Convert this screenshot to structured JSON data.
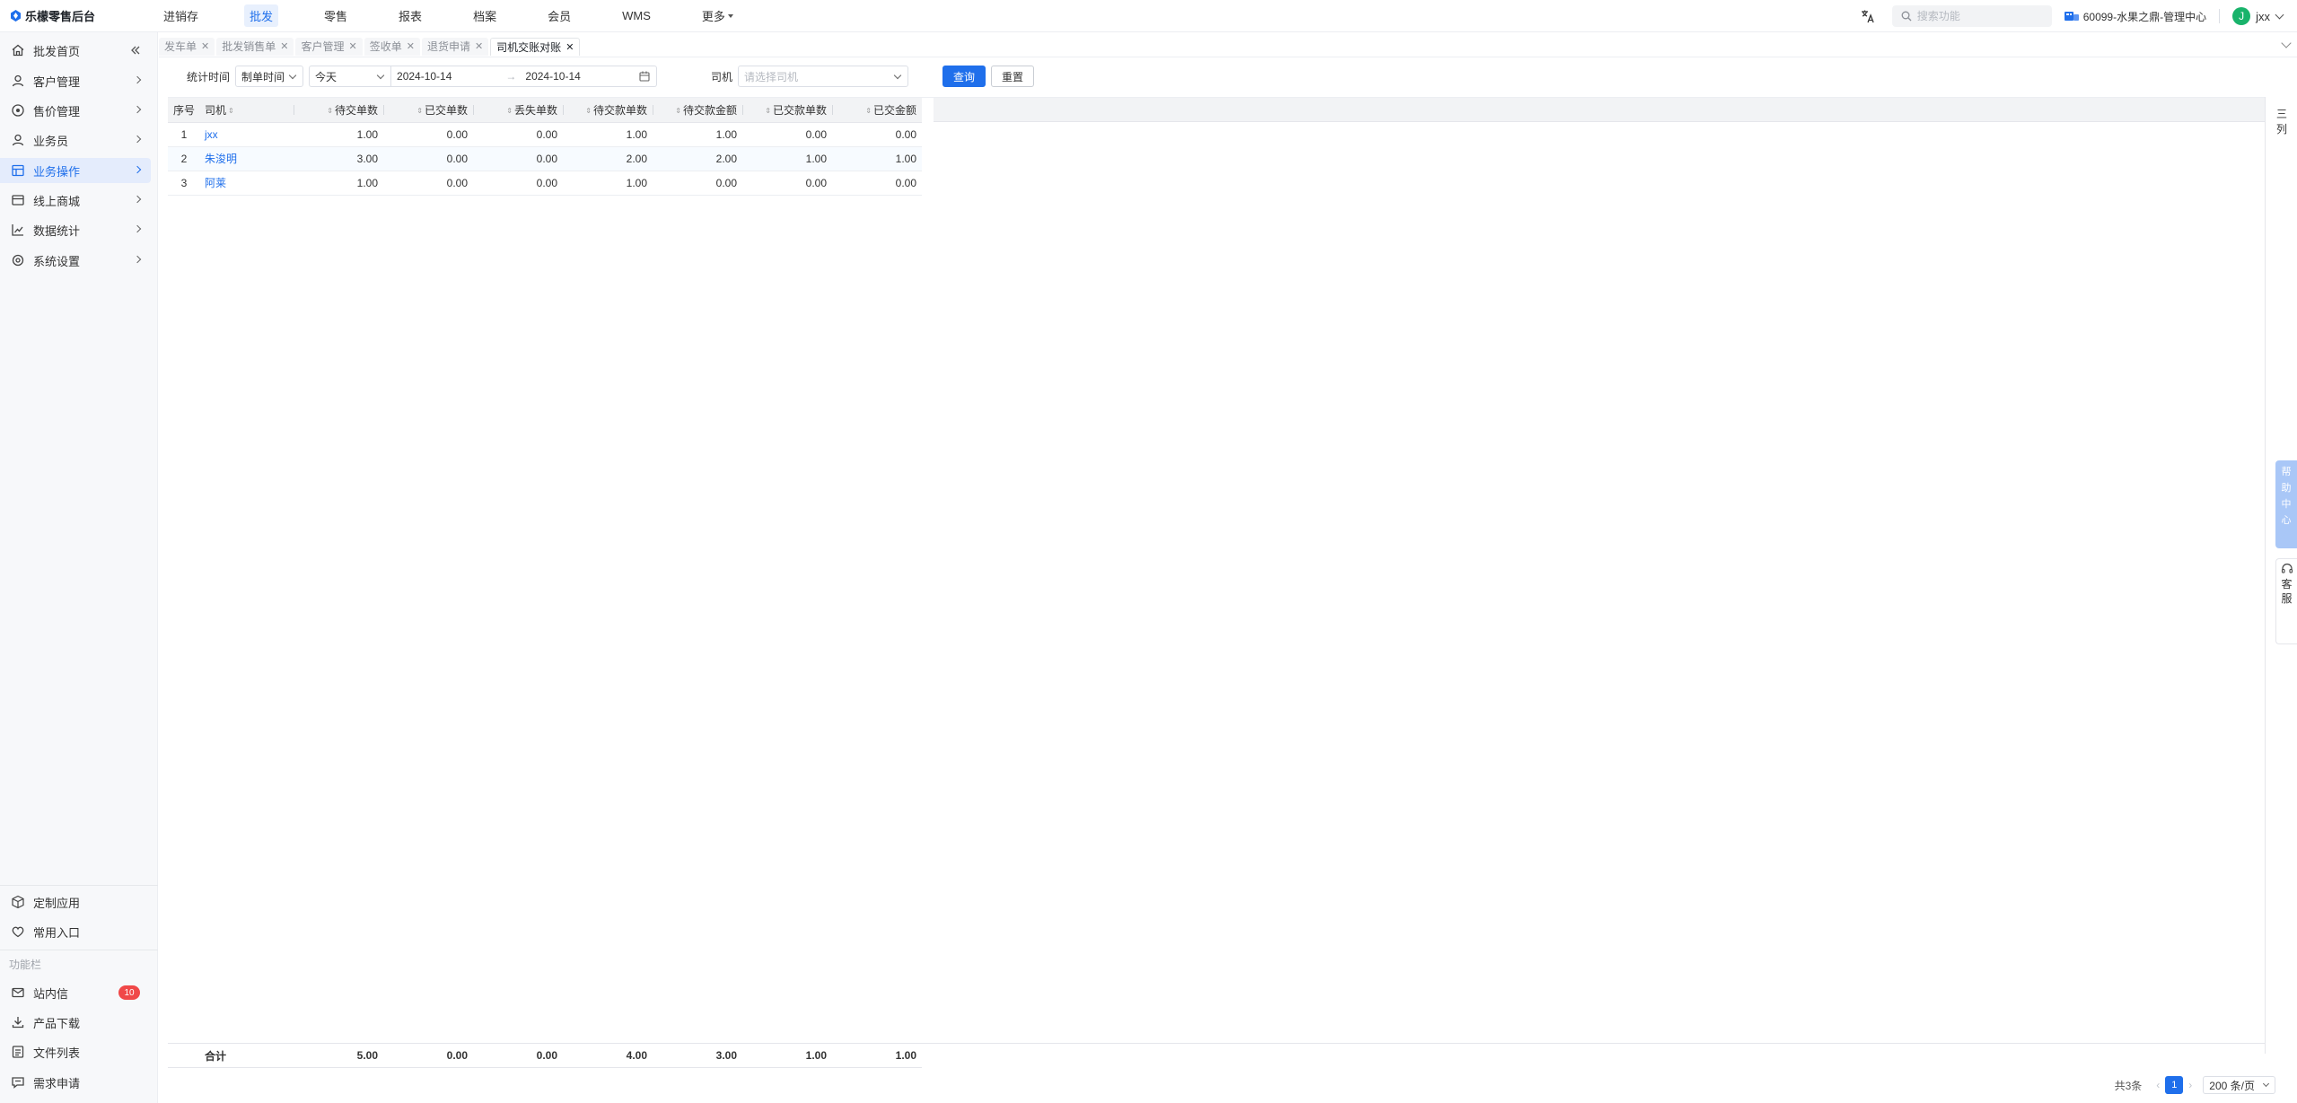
{
  "app": {
    "title": "乐檬零售后台"
  },
  "top_nav": [
    {
      "label": "进销存",
      "active": false
    },
    {
      "label": "批发",
      "active": true
    },
    {
      "label": "零售",
      "active": false
    },
    {
      "label": "报表",
      "active": false
    },
    {
      "label": "档案",
      "active": false
    },
    {
      "label": "会员",
      "active": false
    },
    {
      "label": "WMS",
      "active": false
    },
    {
      "label": "更多",
      "active": false
    }
  ],
  "search": {
    "placeholder": "搜索功能"
  },
  "store": {
    "name": "60099-水果之鼎-管理中心"
  },
  "user": {
    "initial": "J",
    "name": "jxx"
  },
  "sidebar": {
    "items": [
      {
        "label": "批发首页",
        "icon": "home-icon"
      },
      {
        "label": "客户管理",
        "icon": "user-icon"
      },
      {
        "label": "售价管理",
        "icon": "price-icon"
      },
      {
        "label": "业务员",
        "icon": "user-icon"
      },
      {
        "label": "业务操作",
        "icon": "operation-icon",
        "active": true
      },
      {
        "label": "线上商城",
        "icon": "shop-icon"
      },
      {
        "label": "数据统计",
        "icon": "chart-icon"
      },
      {
        "label": "系统设置",
        "icon": "gear-icon"
      }
    ],
    "bottom_items": [
      {
        "label": "定制应用",
        "icon": "cube-icon"
      },
      {
        "label": "常用入口",
        "icon": "heart-icon"
      }
    ],
    "caption": "功能栏",
    "tool_items": [
      {
        "label": "站内信",
        "icon": "mail-icon",
        "badge": "10"
      },
      {
        "label": "产品下载",
        "icon": "download-icon"
      },
      {
        "label": "文件列表",
        "icon": "file-icon"
      },
      {
        "label": "需求申请",
        "icon": "message-icon"
      }
    ]
  },
  "tabs": [
    {
      "label": "发车单",
      "active": false
    },
    {
      "label": "批发销售单",
      "active": false
    },
    {
      "label": "客户管理",
      "active": false
    },
    {
      "label": "签收单",
      "active": false
    },
    {
      "label": "退货申请",
      "active": false
    },
    {
      "label": "司机交账对账",
      "active": true
    }
  ],
  "filters": {
    "time_label": "统计时间",
    "time_type": "制单时间",
    "range_preset": "今天",
    "date_start": "2024-10-14",
    "date_end": "2024-10-14",
    "driver_label": "司机",
    "driver_placeholder": "请选择司机",
    "query_button": "查询",
    "reset_button": "重置"
  },
  "table": {
    "columns": [
      "序号",
      "司机",
      "待交单数",
      "已交单数",
      "丢失单数",
      "待交款单数",
      "待交款金额",
      "已交款单数",
      "已交金额"
    ],
    "rows": [
      [
        "1",
        "jxx",
        "1.00",
        "0.00",
        "0.00",
        "1.00",
        "1.00",
        "0.00",
        "0.00"
      ],
      [
        "2",
        "朱浚明",
        "3.00",
        "0.00",
        "0.00",
        "2.00",
        "2.00",
        "1.00",
        "1.00"
      ],
      [
        "3",
        "阿莱",
        "1.00",
        "0.00",
        "0.00",
        "1.00",
        "0.00",
        "0.00",
        "0.00"
      ]
    ],
    "totals_label": "合计",
    "totals": [
      "5.00",
      "0.00",
      "0.00",
      "4.00",
      "3.00",
      "1.00",
      "1.00"
    ]
  },
  "pager": {
    "total": "共3条",
    "current_page": "1",
    "page_size": "200 条/页"
  },
  "right_panel": {
    "column_setting": [
      "三",
      "列"
    ],
    "help_center": [
      "帮",
      "助",
      "中",
      "心"
    ],
    "service": [
      "客",
      "服"
    ]
  },
  "colors": {
    "accent": "#1f6feb",
    "active_bg": "#e4ecfc",
    "badge": "#f04848",
    "avatar": "#19b36b"
  }
}
